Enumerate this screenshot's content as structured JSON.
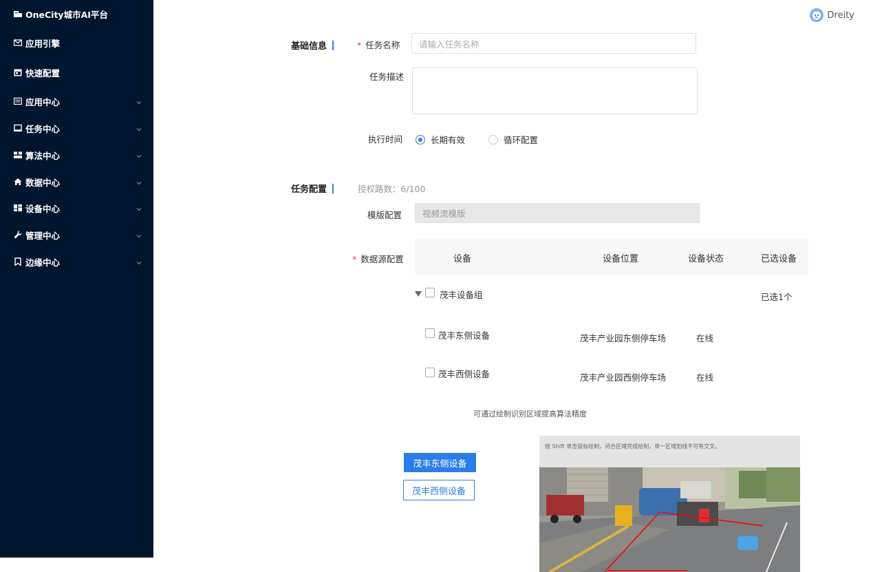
{
  "sidebar": {
    "items": [
      {
        "label": "OneCity城市AI平台",
        "icon": "building-icon",
        "has_chevron": false
      },
      {
        "label": "应用引擎",
        "icon": "mail-icon",
        "has_chevron": false
      },
      {
        "label": "快速配置",
        "icon": "calendar-icon",
        "has_chevron": false
      },
      {
        "label": "应用中心",
        "icon": "list-icon",
        "has_chevron": true
      },
      {
        "label": "任务中心",
        "icon": "monitor-icon",
        "has_chevron": true
      },
      {
        "label": "算法中心",
        "icon": "swap-icon",
        "has_chevron": true
      },
      {
        "label": "数据中心",
        "icon": "home-icon",
        "has_chevron": true
      },
      {
        "label": "设备中心",
        "icon": "dashboard-icon",
        "has_chevron": true
      },
      {
        "label": "管理中心",
        "icon": "wrench-icon",
        "has_chevron": true
      },
      {
        "label": "边缘中心",
        "icon": "bookmark-icon",
        "has_chevron": true
      }
    ]
  },
  "header": {
    "username": "Dreity"
  },
  "basic": {
    "section_title": "基础信息",
    "task_name_label": "任务名称",
    "task_name_placeholder": "请输入任务名称",
    "task_desc_label": "任务描述",
    "exec_time_label": "执行时间",
    "exec_options": [
      "长期有效",
      "循环配置"
    ],
    "exec_selected": "长期有效"
  },
  "config": {
    "section_title": "任务配置",
    "auth_paths": "授权路数：6/100",
    "template_label": "模版配置",
    "template_value": "视频流模版",
    "datasource_label": "数据源配置",
    "columns": [
      "设备",
      "设备位置",
      "设备状态",
      "已选设备"
    ],
    "group": {
      "name": "茂丰设备组",
      "selected_text": "已选1个"
    },
    "devices": [
      {
        "name": "茂丰东侧设备",
        "location": "茂丰产业园东侧停车场",
        "status": "在线"
      },
      {
        "name": "茂丰西侧设备",
        "location": "茂丰产业园西侧停车场",
        "status": "在线"
      }
    ]
  },
  "draw": {
    "hint": "可通过绘制识别区域提高算法精度",
    "device_tabs": [
      "茂丰东侧设备",
      "茂丰西侧设备"
    ],
    "active_tab": "茂丰东侧设备",
    "canvas_tip": "按 Shift 单击鼠标绘制，闭合区域完成绘制，单一区域划线不可有交叉。",
    "line_color": "#ff0000"
  },
  "colors": {
    "accent": "#2b7de9",
    "sidebar_bg": "#00162e",
    "required": "#e23c3c"
  }
}
